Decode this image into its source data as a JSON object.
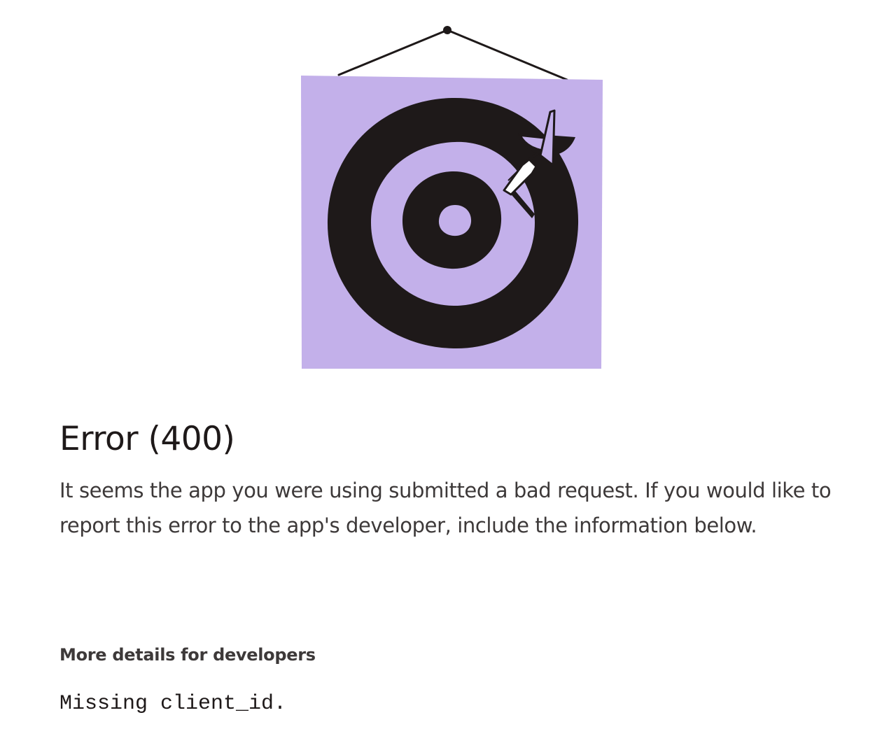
{
  "error": {
    "title": "Error (400)",
    "description": "It seems the app you were using submitted a bad request. If you would like to report this error to the app's developer, include the information below."
  },
  "details": {
    "heading": "More details for developers",
    "message": "Missing client_id."
  },
  "illustration": {
    "icon": "hanging-target-dart-icon",
    "colors": {
      "background": "#c3b0ea",
      "ink": "#1e1919"
    }
  }
}
